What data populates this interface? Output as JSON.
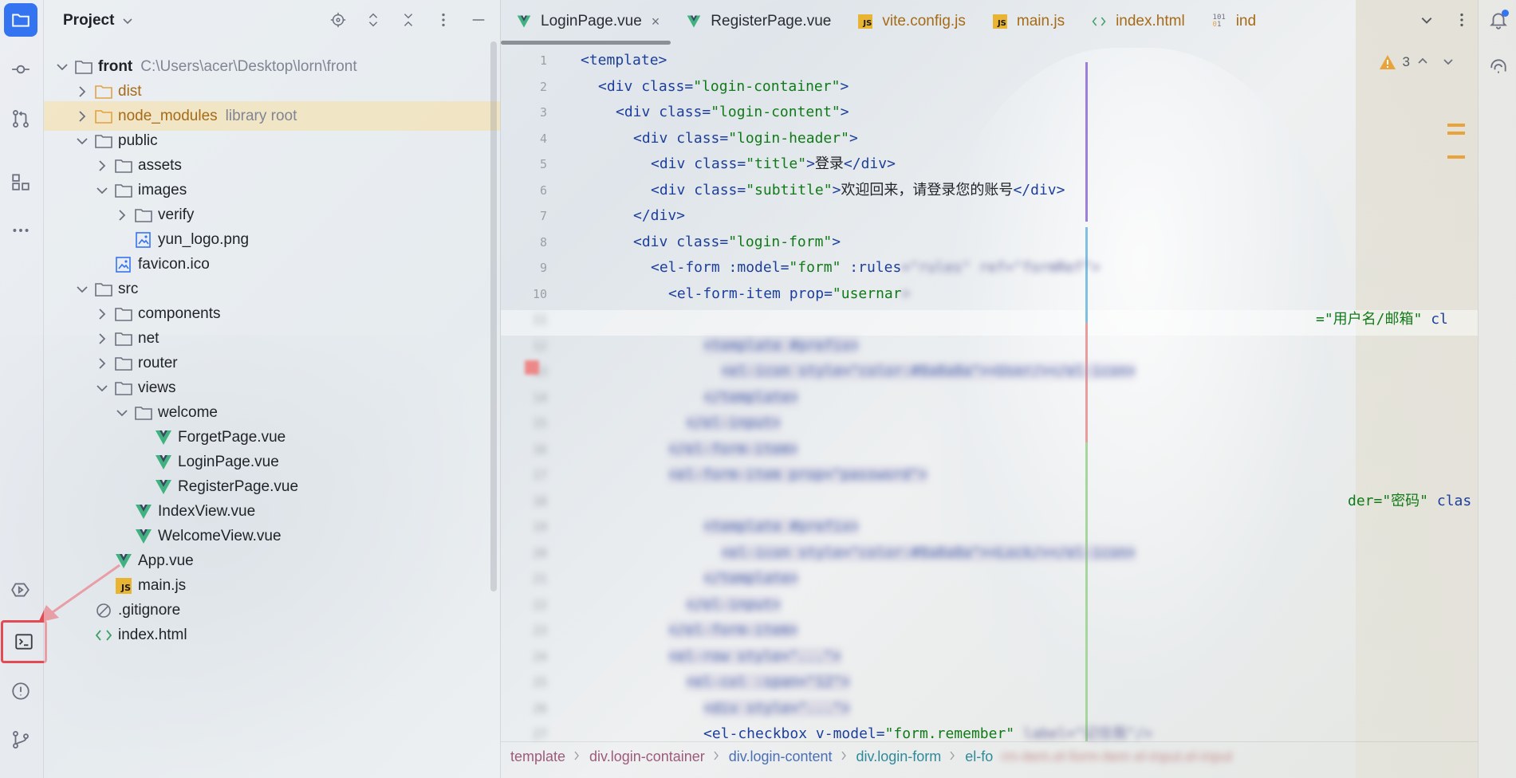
{
  "project_panel": {
    "title": "Project",
    "tree": [
      {
        "name": "front",
        "extra": "C:\\Users\\acer\\Desktop\\lorn\\front",
        "type": "folder",
        "expanded": true
      },
      {
        "name": "dist",
        "extra": "",
        "type": "folder-orange",
        "expanded": false
      },
      {
        "name": "node_modules",
        "extra": "library root",
        "type": "folder-orange",
        "expanded": false,
        "selected": true
      },
      {
        "name": "public",
        "extra": "",
        "type": "folder",
        "expanded": true
      },
      {
        "name": "assets",
        "extra": "",
        "type": "folder",
        "expanded": false
      },
      {
        "name": "images",
        "extra": "",
        "type": "folder",
        "expanded": true
      },
      {
        "name": "verify",
        "extra": "",
        "type": "folder",
        "expanded": false
      },
      {
        "name": "yun_logo.png",
        "extra": "",
        "type": "image"
      },
      {
        "name": "favicon.ico",
        "extra": "",
        "type": "image"
      },
      {
        "name": "src",
        "extra": "",
        "type": "folder",
        "expanded": true
      },
      {
        "name": "components",
        "extra": "",
        "type": "folder",
        "expanded": false
      },
      {
        "name": "net",
        "extra": "",
        "type": "folder",
        "expanded": false
      },
      {
        "name": "router",
        "extra": "",
        "type": "folder",
        "expanded": false
      },
      {
        "name": "views",
        "extra": "",
        "type": "folder",
        "expanded": true
      },
      {
        "name": "welcome",
        "extra": "",
        "type": "folder",
        "expanded": true
      },
      {
        "name": "ForgetPage.vue",
        "extra": "",
        "type": "vue"
      },
      {
        "name": "LoginPage.vue",
        "extra": "",
        "type": "vue"
      },
      {
        "name": "RegisterPage.vue",
        "extra": "",
        "type": "vue"
      },
      {
        "name": "IndexView.vue",
        "extra": "",
        "type": "vue"
      },
      {
        "name": "WelcomeView.vue",
        "extra": "",
        "type": "vue"
      },
      {
        "name": "App.vue",
        "extra": "",
        "type": "vue"
      },
      {
        "name": "main.js",
        "extra": "",
        "type": "js"
      },
      {
        "name": ".gitignore",
        "extra": "",
        "type": "ignore"
      },
      {
        "name": "index.html",
        "extra": "",
        "type": "html"
      }
    ]
  },
  "tabs": [
    {
      "label": "LoginPage.vue",
      "icon": "vue-icon",
      "active": true,
      "close": "×"
    },
    {
      "label": "RegisterPage.vue",
      "icon": "vue-icon",
      "active": false
    },
    {
      "label": "vite.config.js",
      "icon": "js-icon",
      "active": false
    },
    {
      "label": "main.js",
      "icon": "js-icon",
      "active": false
    },
    {
      "label": "index.html",
      "icon": "html-icon",
      "active": false
    },
    {
      "label": "ind",
      "icon": "binary-icon",
      "active": false
    }
  ],
  "editor": {
    "warning_count": "3",
    "line_numbers": [
      "1",
      "2",
      "3",
      "4",
      "5",
      "6",
      "7",
      "8",
      "9",
      "10",
      "11",
      "12",
      "13",
      "14",
      "15",
      "16",
      "17",
      "18",
      "19",
      "20",
      "21",
      "22",
      "23",
      "24",
      "25",
      "26",
      "27"
    ],
    "lines": [
      {
        "indent": 1,
        "parts": [
          [
            "tag",
            "<template>"
          ]
        ]
      },
      {
        "indent": 2,
        "parts": [
          [
            "tag",
            "<div "
          ],
          [
            "attr",
            "class="
          ],
          [
            "str",
            "\"login-container\""
          ],
          [
            "tag",
            ">"
          ]
        ]
      },
      {
        "indent": 3,
        "parts": [
          [
            "tag",
            "<div "
          ],
          [
            "attr",
            "class="
          ],
          [
            "str",
            "\"login-content\""
          ],
          [
            "tag",
            ">"
          ]
        ]
      },
      {
        "indent": 4,
        "parts": [
          [
            "tag",
            "<div "
          ],
          [
            "attr",
            "class="
          ],
          [
            "str",
            "\"login-header\""
          ],
          [
            "tag",
            ">"
          ]
        ]
      },
      {
        "indent": 5,
        "parts": [
          [
            "tag",
            "<div "
          ],
          [
            "attr",
            "class="
          ],
          [
            "str",
            "\"title\""
          ],
          [
            "tag",
            ">"
          ],
          [
            "txt",
            "登录"
          ],
          [
            "tag",
            "</div>"
          ]
        ]
      },
      {
        "indent": 5,
        "parts": [
          [
            "tag",
            "<div "
          ],
          [
            "attr",
            "class="
          ],
          [
            "str",
            "\"subtitle\""
          ],
          [
            "tag",
            ">"
          ],
          [
            "txt",
            "欢迎回来，请登录您的账号"
          ],
          [
            "tag",
            "</div>"
          ]
        ]
      },
      {
        "indent": 4,
        "parts": [
          [
            "tag",
            "</div>"
          ]
        ]
      },
      {
        "indent": 4,
        "parts": [
          [
            "tag",
            "<div "
          ],
          [
            "attr",
            "class="
          ],
          [
            "str",
            "\"login-form\""
          ],
          [
            "tag",
            ">"
          ]
        ]
      },
      {
        "indent": 5,
        "parts": [
          [
            "tag",
            "<el-form "
          ],
          [
            "attr",
            ":model="
          ],
          [
            "str",
            "\"form\""
          ],
          [
            "attr",
            " :rules"
          ]
        ]
      },
      {
        "indent": 6,
        "parts": [
          [
            "tag",
            "<el-form-item "
          ],
          [
            "attr",
            "prop="
          ],
          [
            "str",
            "\"usernar"
          ]
        ]
      },
      {
        "indent": 7,
        "parts": [
          [
            "str",
            "=\"用户名/邮箱\""
          ],
          [
            "attr",
            " cl"
          ]
        ]
      },
      {
        "indent": 8,
        "parts": []
      },
      {
        "indent": 9,
        "parts": []
      },
      {
        "indent": 8,
        "parts": []
      },
      {
        "indent": 7,
        "parts": []
      },
      {
        "indent": 6,
        "parts": []
      },
      {
        "indent": 6,
        "parts": []
      },
      {
        "indent": 7,
        "parts": [
          [
            "str",
            "der=\"密码\""
          ],
          [
            "attr",
            " clas"
          ]
        ]
      },
      {
        "indent": 8,
        "parts": []
      },
      {
        "indent": 9,
        "parts": []
      },
      {
        "indent": 8,
        "parts": []
      },
      {
        "indent": 7,
        "parts": []
      },
      {
        "indent": 6,
        "parts": []
      },
      {
        "indent": 6,
        "parts": []
      },
      {
        "indent": 7,
        "parts": []
      },
      {
        "indent": 8,
        "parts": []
      },
      {
        "indent": 8,
        "parts": [
          [
            "tag",
            "<el-checkbox "
          ],
          [
            "attr",
            "v-model="
          ],
          [
            "str",
            "\"form.remember\""
          ]
        ]
      }
    ]
  },
  "breadcrumbs": [
    "template",
    "div.login-container",
    "div.login-content",
    "div.login-form",
    "el-fo"
  ],
  "colors": {
    "accent": "#3574f0",
    "highlight_box": "#e24a54",
    "annotation_arrow": "#e24a54"
  }
}
